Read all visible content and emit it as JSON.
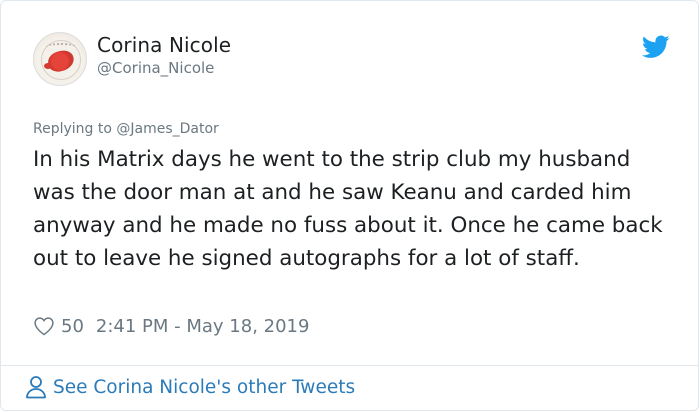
{
  "tweet": {
    "display_name": "Corina Nicole",
    "handle": "@Corina_Nicole",
    "reply_prefix": "Replying to ",
    "reply_to": "@James_Dator",
    "text": "In his Matrix days he went to the strip club my husband was the door man at and he saw Keanu and carded him anyway and he made no fuss about it. Once he came back out to leave he signed autographs for a lot of staff.",
    "likes": "50",
    "timestamp": "2:41 PM - May 18, 2019"
  },
  "footer": {
    "link_label": "See Corina Nicole's other Tweets"
  },
  "icons": {
    "brand": "twitter-bird-icon",
    "like": "heart-icon",
    "profile": "person-icon"
  },
  "colors": {
    "brand_blue": "#1da1f2",
    "link_blue": "#2b7bb9",
    "muted": "#697882",
    "text": "#1c2022",
    "border": "#e1e8ed"
  }
}
